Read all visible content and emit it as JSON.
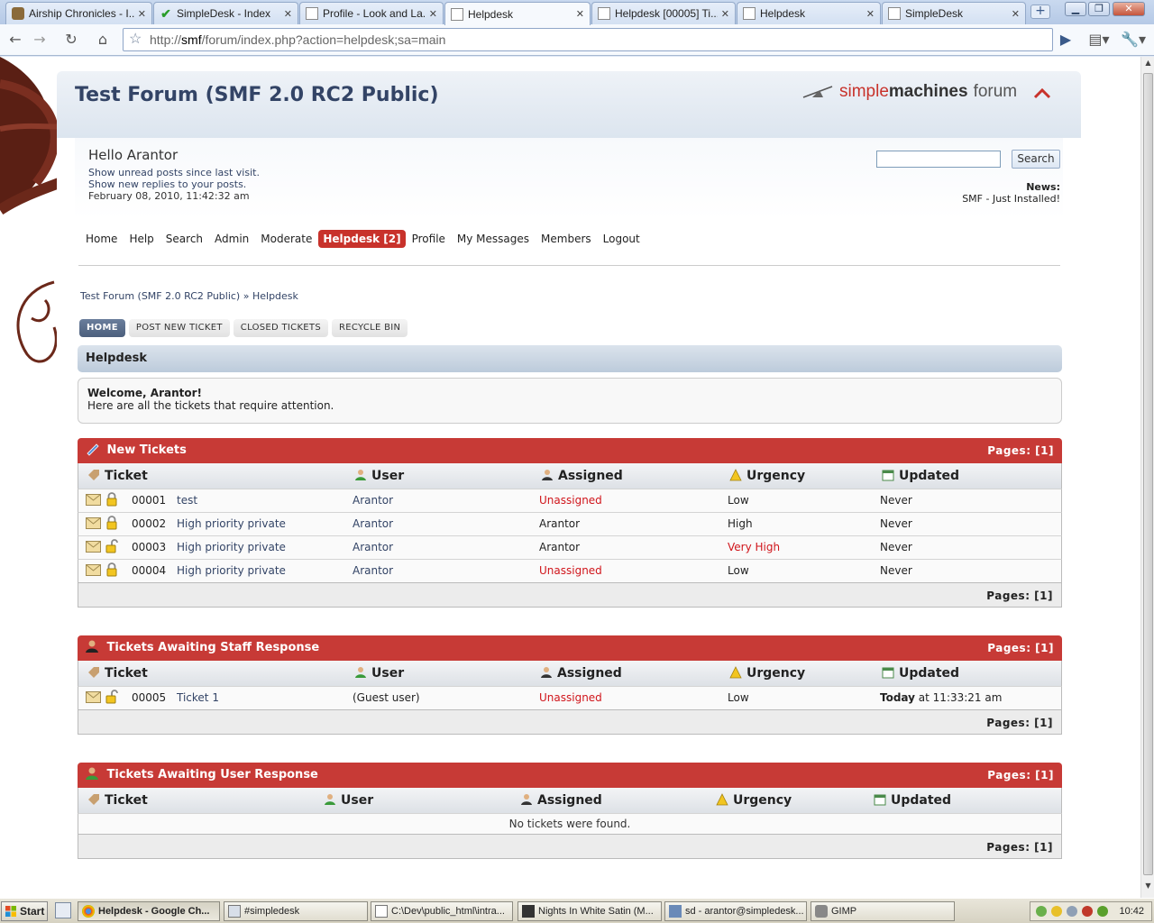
{
  "browser": {
    "tabs": [
      {
        "title": "Airship Chronicles - I...",
        "icon": "airship-favicon"
      },
      {
        "title": "SimpleDesk - Index",
        "icon": "check-favicon"
      },
      {
        "title": "Profile - Look and La...",
        "icon": "page-favicon"
      },
      {
        "title": "Helpdesk",
        "icon": "page-favicon",
        "active": true
      },
      {
        "title": "Helpdesk [00005] Ti...",
        "icon": "page-favicon"
      },
      {
        "title": "Helpdesk",
        "icon": "page-favicon"
      },
      {
        "title": "SimpleDesk",
        "icon": "page-favicon"
      }
    ],
    "new_tab": "+",
    "url_prefix": "http://",
    "url_host": "smf",
    "url_rest": "/forum/index.php?action=helpdesk;sa=main"
  },
  "forum": {
    "title": "Test Forum (SMF 2.0 RC2 Public)",
    "logo_simple": "simple",
    "logo_machines": "machines",
    "logo_forum": "forum",
    "hello": "Hello Arantor",
    "unread_link": "Show unread posts since last visit.",
    "replies_link": "Show new replies to your posts.",
    "datetime": "February 08, 2010, 11:42:32 am",
    "search_button": "Search",
    "news_label": "News:",
    "news_text": "SMF - Just Installed!",
    "accent": "#c73a36"
  },
  "menu": [
    "Home",
    "Help",
    "Search",
    "Admin",
    "Moderate",
    "Helpdesk [2]",
    "Profile",
    "My Messages",
    "Members",
    "Logout"
  ],
  "breadcrumb": {
    "root": "Test Forum (SMF 2.0 RC2 Public)",
    "sep": "»",
    "current": "Helpdesk"
  },
  "buttons": [
    "HOME",
    "POST NEW TICKET",
    "CLOSED TICKETS",
    "RECYCLE BIN"
  ],
  "helpdesk_title": "Helpdesk",
  "welcome": {
    "title": "Welcome, Arantor!",
    "text": "Here are all the tickets that require attention."
  },
  "columns": {
    "ticket": "Ticket",
    "user": "User",
    "assigned": "Assigned",
    "urgency": "Urgency",
    "updated": "Updated"
  },
  "pages_label": "Pages: [1]",
  "blocks": {
    "new": {
      "title": "New Tickets",
      "rows": [
        {
          "id": "00001",
          "subject": "test",
          "user": "Arantor",
          "assigned": "Unassigned",
          "urgency": "Low",
          "updated": "Never"
        },
        {
          "id": "00002",
          "subject": "High priority private",
          "user": "Arantor",
          "assigned": "Arantor",
          "urgency": "High",
          "updated": "Never"
        },
        {
          "id": "00003",
          "subject": "High priority private",
          "user": "Arantor",
          "assigned": "Arantor",
          "urgency": "Very High",
          "updated": "Never"
        },
        {
          "id": "00004",
          "subject": "High priority private",
          "user": "Arantor",
          "assigned": "Unassigned",
          "urgency": "Low",
          "updated": "Never"
        }
      ]
    },
    "staff": {
      "title": "Tickets Awaiting Staff Response",
      "rows": [
        {
          "id": "00005",
          "subject": "Ticket 1",
          "user": "(Guest user)",
          "assigned": "Unassigned",
          "urgency": "Low",
          "updated_bold": "Today",
          "updated": " at 11:33:21 am"
        }
      ]
    },
    "user": {
      "title": "Tickets Awaiting User Response",
      "empty": "No tickets were found."
    }
  },
  "taskbar": {
    "start": "Start",
    "tasks": [
      "Helpdesk - Google Ch...",
      "#simpledesk",
      "C:\\Dev\\public_html\\intra...",
      "Nights In White Satin (M...",
      "sd - arantor@simpledesk...",
      "GIMP"
    ],
    "clock": "10:42"
  }
}
